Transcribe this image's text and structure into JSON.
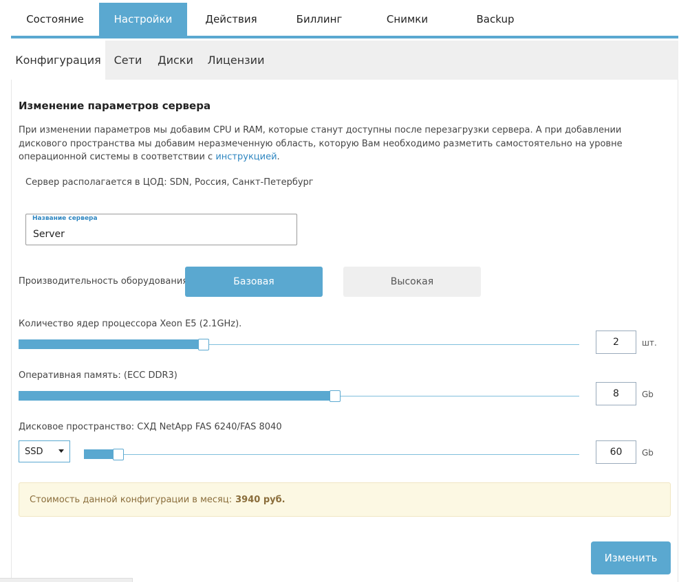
{
  "top_tabs": [
    {
      "label": "Состояние"
    },
    {
      "label": "Настройки"
    },
    {
      "label": "Действия"
    },
    {
      "label": "Биллинг"
    },
    {
      "label": "Снимки"
    },
    {
      "label": "Backup"
    }
  ],
  "sub_tabs": [
    {
      "label": "Конфигурация"
    },
    {
      "label": "Сети"
    },
    {
      "label": "Диски"
    },
    {
      "label": "Лицензии"
    }
  ],
  "section_title": "Изменение параметров сервера",
  "description": {
    "text": "При изменении параметров мы добавим CPU и RAM, которые станут доступны после перезагрузки сервера. А при добавлении дискового пространства мы добавим неразмеченную область, которую Вам необходимо разметить самостоятельно на уровне операционной системы в соответствии с ",
    "link": "инструкцией",
    "end": "."
  },
  "location_text": "Сервер располагается в ЦОД: SDN, Россия, Санкт-Петербург",
  "server_name": {
    "label": "Название сервера",
    "value": "Server"
  },
  "performance": {
    "label": "Производительность оборудования",
    "options": [
      "Базовая",
      "Высокая"
    ],
    "selected": "Базовая"
  },
  "cpu": {
    "label": "Количество ядер процессора Xeon E5 (2.1GHz).",
    "value": "2",
    "unit": "шт.",
    "fraction": 0.33
  },
  "ram": {
    "label": "Оперативная память: (ECC DDR3)",
    "value": "8",
    "unit": "Gb",
    "fraction": 0.565
  },
  "disk": {
    "label": "Дисковое пространство: СХД NetApp FAS 6240/FAS 8040",
    "type": "SSD",
    "value": "60",
    "unit": "Gb",
    "fraction": 0.07
  },
  "cost": {
    "label": "Стоимость данной конфигурации в месяц:",
    "value": "3940 руб."
  },
  "submit_label": "Изменить",
  "colors": {
    "accent": "#5aa8d0",
    "notice_bg": "#fcf8e3",
    "notice_text": "#8a6d3b"
  }
}
